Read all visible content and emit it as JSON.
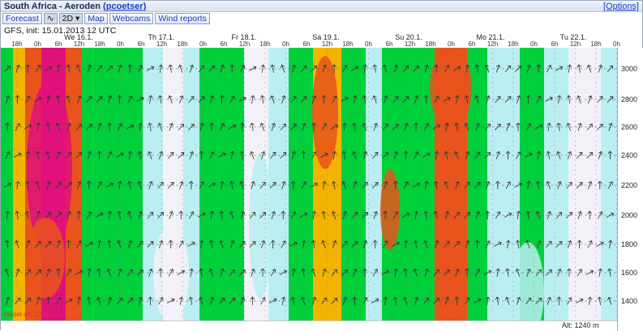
{
  "header": {
    "title": "South Africa - Aeroden",
    "user": "(pcoetser)",
    "options": "[Options]"
  },
  "toolbar": {
    "forecast": "Forecast",
    "wave_glyph": "∿",
    "view_2d": "2D",
    "map": "Map",
    "webcams": "Webcams",
    "wind_reports": "Wind reports"
  },
  "model_info": "GFS, init: 15.01.2013 12 UTC",
  "days": [
    "We 16.1.",
    "Th 17.1.",
    "Fr 18.1.",
    "Sa 19.1.",
    "Su 20.1.",
    "Mo 21.1.",
    "Tu 22.1."
  ],
  "hours": [
    "18h",
    "0h",
    "6h",
    "12h",
    "18h",
    "0h",
    "6h",
    "12h",
    "18h",
    "0h",
    "6h",
    "12h",
    "18h",
    "0h",
    "6h",
    "12h",
    "18h",
    "0h",
    "6h",
    "12h",
    "18h",
    "0h",
    "6h",
    "12h",
    "18h",
    "0h",
    "6h",
    "12h",
    "18h",
    "0h"
  ],
  "y_axis": {
    "labels": [
      "3000",
      "2800",
      "2600",
      "2400",
      "2200",
      "2000",
      "1800",
      "1600",
      "1400"
    ]
  },
  "model_height": "model alt: 1240 m",
  "altitude": "Alt: 1240 m",
  "colors": {
    "calm": "#f3f1f8",
    "light": "#b9eef2",
    "moderate": "#00d03a",
    "strong": "#f2b400",
    "very_strong": "#e8541c",
    "extreme": "#e0107a"
  }
}
